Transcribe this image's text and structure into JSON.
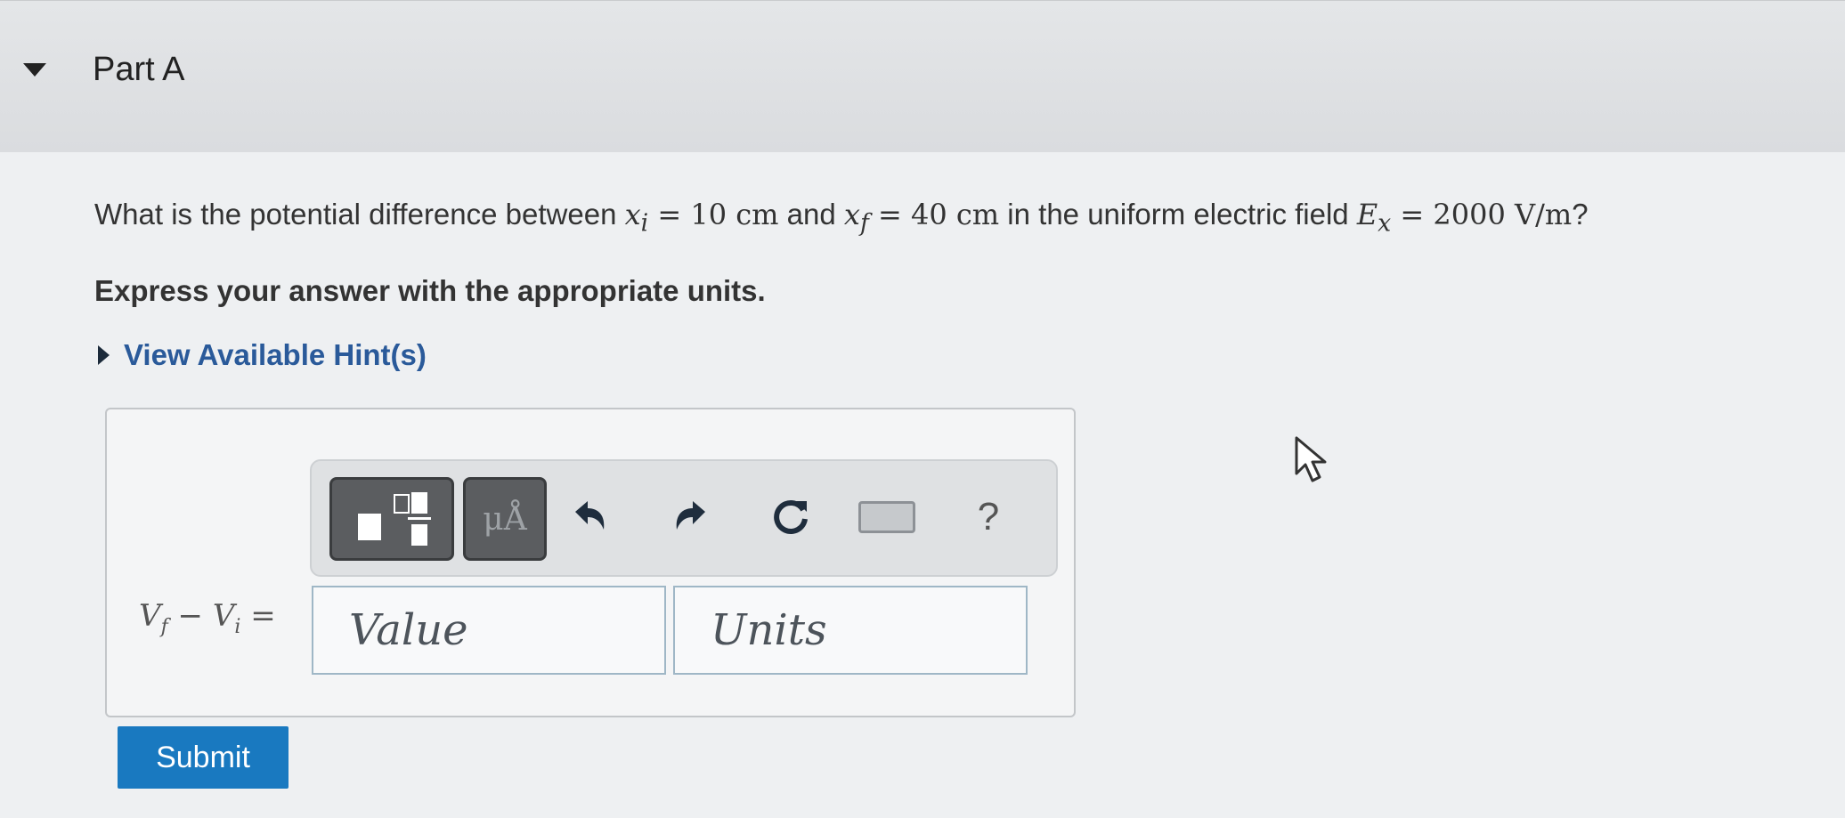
{
  "part": {
    "title": "Part A"
  },
  "question": {
    "pre": "What is the potential difference between ",
    "xi_var": "x",
    "xi_sub": "i",
    "xi_eq": " = 10 ",
    "xi_unit": "cm",
    "mid": " and ",
    "xf_var": "x",
    "xf_sub": "f",
    "xf_eq": " = 40 ",
    "xf_unit": "cm",
    "mid2": " in the uniform electric field ",
    "e_var": "E",
    "e_sub": "x",
    "e_eq": " = 2000 ",
    "e_unit": "V/m",
    "end": "?"
  },
  "instruction": "Express your answer with the appropriate units.",
  "hint": {
    "label": "View Available Hint(s)"
  },
  "toolbar": {
    "units_symbol": "μÅ",
    "help_label": "?",
    "icons": [
      "templates-icon",
      "units-icon",
      "undo-icon",
      "redo-icon",
      "reset-icon",
      "keyboard-icon",
      "help-icon"
    ]
  },
  "answer": {
    "lhs_vf": "V",
    "lhs_vf_sub": "f",
    "lhs_minus": " − ",
    "lhs_vi": "V",
    "lhs_vi_sub": "i",
    "lhs_eq": " =",
    "value_placeholder": "Value",
    "units_placeholder": "Units"
  },
  "submit": {
    "label": "Submit"
  },
  "colors": {
    "submit": "#1979c0",
    "hint_link": "#2a5a9a",
    "header_bg": "#dcdee1"
  }
}
